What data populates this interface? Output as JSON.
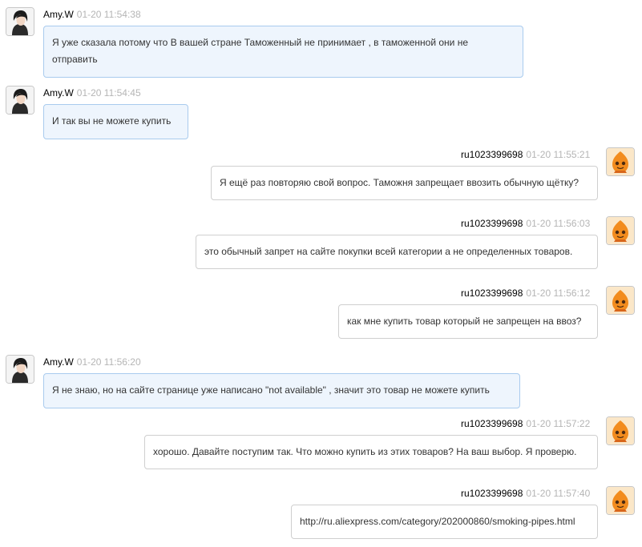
{
  "messages": [
    {
      "sender": "Amy.W",
      "time": "01-20 11:54:38",
      "text": "Я уже сказала потому что В вашей стране Таможенный не принимает , в таможенной они не отправить"
    },
    {
      "sender": "Amy.W",
      "time": "01-20 11:54:45",
      "text": "И так вы не можете купить"
    },
    {
      "sender": "ru1023399698",
      "time": "01-20 11:55:21",
      "text": "Я ещё раз повторяю свой вопрос. Таможня запрещает ввозить обычную щётку?"
    },
    {
      "sender": "ru1023399698",
      "time": "01-20 11:56:03",
      "text": "это обычный запрет на сайте покупки всей категории а не определенных товаров."
    },
    {
      "sender": "ru1023399698",
      "time": "01-20 11:56:12",
      "text": "как мне купить товар который не запрещен на ввоз?"
    },
    {
      "sender": "Amy.W",
      "time": "01-20 11:56:20",
      "text": "Я не знаю, но на сайте странице уже написано \"not available\" , значит это товар не можете купить"
    },
    {
      "sender": "ru1023399698",
      "time": "01-20 11:57:22",
      "text": "хорошо. Давайте поступим так. Что можно купить из этих товаров? На ваш выбор. Я проверю."
    },
    {
      "sender": "ru1023399698",
      "time": "01-20 11:57:40",
      "text": "http://ru.aliexpress.com/category/202000860/smoking-pipes.html"
    }
  ],
  "colors": {
    "incoming_bubble": "#eef5fd",
    "incoming_border": "#a9cbee",
    "outgoing_bubble": "#ffffff",
    "outgoing_border": "#cfcfcf",
    "timestamp": "#b5b5b5",
    "customer_avatar": "#f28c1e"
  },
  "icons": {
    "agent_avatar": "woman-portrait-avatar",
    "customer_avatar": "orange-mascot-avatar"
  }
}
